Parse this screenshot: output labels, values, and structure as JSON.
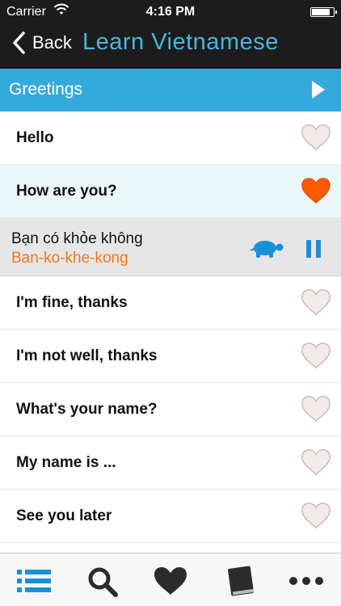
{
  "status_bar": {
    "carrier": "Carrier",
    "time": "4:16 PM",
    "battery_level": 0.9
  },
  "nav": {
    "back_label": "Back",
    "title": "Learn Vietnamese"
  },
  "section": {
    "title": "Greetings"
  },
  "phrases": [
    {
      "text": "Hello",
      "favorite": false
    },
    {
      "text": "How are you?",
      "favorite": true,
      "selected": true
    },
    {
      "text": "I'm fine, thanks",
      "favorite": false
    },
    {
      "text": "I'm not well, thanks",
      "favorite": false
    },
    {
      "text": "What's your name?",
      "favorite": false
    },
    {
      "text": "My name is ...",
      "favorite": false
    },
    {
      "text": "See you later",
      "favorite": false
    }
  ],
  "detail": {
    "vietnamese": "Bạn có khỏe không",
    "pronunciation": "Ban-ko-khe-kong"
  },
  "tabs": [
    {
      "icon": "list-icon",
      "active": true
    },
    {
      "icon": "search-icon",
      "active": false
    },
    {
      "icon": "heart-icon",
      "active": false
    },
    {
      "icon": "book-icon",
      "active": false
    },
    {
      "icon": "more-icon",
      "active": false
    }
  ],
  "colors": {
    "nav_bg": "#1c1c1c",
    "title": "#4ab5de",
    "section_bg": "#34aadc",
    "selected_row_bg": "#eaf7fb",
    "detail_bg": "#e6e6e6",
    "pronunciation": "#f0781e",
    "accent": "#1a8fd8",
    "heart_fav": "#ff5a00",
    "heart_off": "#eadcdc"
  }
}
